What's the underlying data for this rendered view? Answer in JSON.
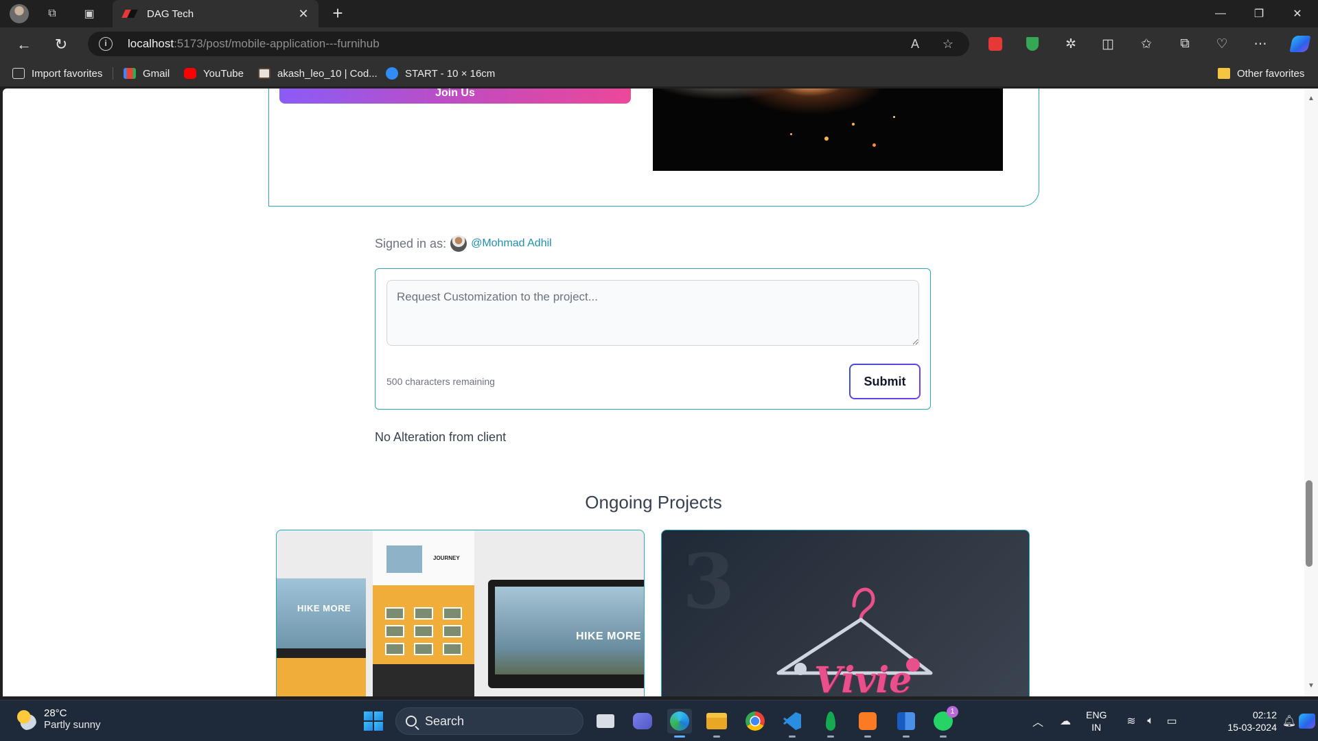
{
  "browser": {
    "tab_title": "DAG Tech",
    "url_host": "localhost",
    "url_rest": ":5173/post/mobile-application---furnihub"
  },
  "bookmarks": [
    {
      "label": "Import favorites",
      "icon": "import-icon"
    },
    {
      "label": "Gmail",
      "icon": "gmail-icon",
      "color": "#ea4335"
    },
    {
      "label": "YouTube",
      "icon": "youtube-icon",
      "color": "#ff0000"
    },
    {
      "label": "akash_leo_10 | Cod...",
      "icon": "codechef-icon",
      "color": "#5b4638"
    },
    {
      "label": "START - 10 × 16cm",
      "icon": "canva-icon",
      "color": "#2f8df5"
    }
  ],
  "other_favorites": "Other favorites",
  "hero": {
    "join_label": "Join Us"
  },
  "comment": {
    "signed_in_label": "Signed in as:",
    "username": "@Mohmad Adhil",
    "placeholder": "Request Customization to the project...",
    "chars_remaining": "500 characters remaining",
    "submit_label": "Submit",
    "no_alteration": "No Alteration from client"
  },
  "ongoing": {
    "title": "Ongoing Projects",
    "projects": [
      {
        "hero_text": "HIKE MORE",
        "journey_text": "JOURNEY"
      },
      {
        "brand_text": "Vivie"
      }
    ]
  },
  "taskbar": {
    "temperature": "28°C",
    "weather": "Partly sunny",
    "search_label": "Search",
    "whatsapp_badge": "1",
    "lang_top": "ENG",
    "lang_bottom": "IN",
    "time": "02:12",
    "date": "15-03-2024"
  },
  "colors": {
    "accent_teal": "#2aa6b8",
    "link_blue": "#1f8fb0",
    "join_gradient_start": "#8a5cf6",
    "join_gradient_end": "#ec4899"
  }
}
